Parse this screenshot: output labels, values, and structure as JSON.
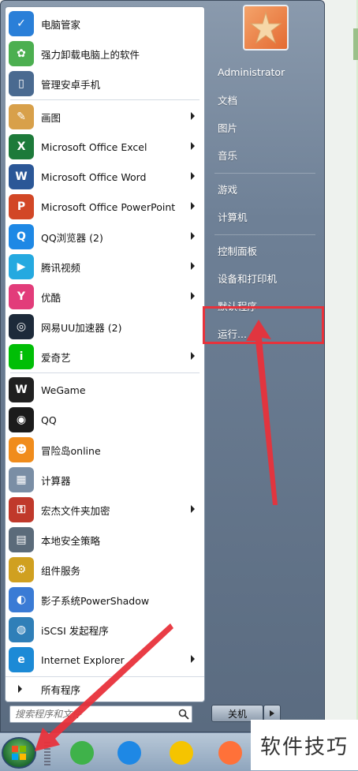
{
  "programs": [
    {
      "label": "电脑管家",
      "icon": "shield-icon",
      "color": "#2a7fd8",
      "submenu": false
    },
    {
      "label": "强力卸载电脑上的软件",
      "icon": "clover-icon",
      "color": "#4caf50",
      "submenu": false
    },
    {
      "label": "管理安卓手机",
      "icon": "phone-icon",
      "color": "#4a6a90",
      "submenu": false
    },
    {
      "label": "画图",
      "icon": "palette-icon",
      "color": "#d8a04a",
      "submenu": true
    },
    {
      "label": "Microsoft Office Excel",
      "icon": "excel-icon",
      "color": "#1d7a3a",
      "submenu": true
    },
    {
      "label": "Microsoft Office Word",
      "icon": "word-icon",
      "color": "#2b5797",
      "submenu": true
    },
    {
      "label": "Microsoft Office PowerPoint",
      "icon": "powerpoint-icon",
      "color": "#d24726",
      "submenu": true
    },
    {
      "label": "QQ浏览器 (2)",
      "icon": "qq-browser-icon",
      "color": "#1e88e5",
      "submenu": true
    },
    {
      "label": "腾讯视频",
      "icon": "tencent-video-icon",
      "color": "#25a9e0",
      "submenu": true
    },
    {
      "label": "优酷",
      "icon": "youku-icon",
      "color": "#e23c7a",
      "submenu": true
    },
    {
      "label": "网易UU加速器 (2)",
      "icon": "uu-accelerator-icon",
      "color": "#1d2a3a",
      "submenu": false
    },
    {
      "label": "爱奇艺",
      "icon": "iqiyi-icon",
      "color": "#00be06",
      "submenu": true
    },
    {
      "label": "WeGame",
      "icon": "wegame-icon",
      "color": "#202020",
      "submenu": false
    },
    {
      "label": "QQ",
      "icon": "qq-penguin-icon",
      "color": "#1b1b1b",
      "submenu": false
    },
    {
      "label": "冒险岛online",
      "icon": "maplestory-icon",
      "color": "#f08c1c",
      "submenu": false
    },
    {
      "label": "计算器",
      "icon": "calculator-icon",
      "color": "#7a8ea5",
      "submenu": false
    },
    {
      "label": "宏杰文件夹加密",
      "icon": "lock-icon",
      "color": "#c0392b",
      "submenu": true
    },
    {
      "label": "本地安全策略",
      "icon": "security-policy-icon",
      "color": "#5b6b7a",
      "submenu": false
    },
    {
      "label": "组件服务",
      "icon": "component-services-icon",
      "color": "#d0a020",
      "submenu": false
    },
    {
      "label": "影子系统PowerShadow",
      "icon": "powershadow-icon",
      "color": "#3a7bd5",
      "submenu": false
    },
    {
      "label": "iSCSI 发起程序",
      "icon": "iscsi-globe-icon",
      "color": "#2f7fb8",
      "submenu": false
    },
    {
      "label": "Internet Explorer",
      "icon": "internet-explorer-icon",
      "color": "#1c8ad6",
      "submenu": true
    }
  ],
  "all_programs_label": "所有程序",
  "search": {
    "placeholder": "搜索程序和文件"
  },
  "right_pane": {
    "user": "Administrator",
    "links_group1": [
      "文档",
      "图片",
      "音乐"
    ],
    "links_group2": [
      "游戏",
      "计算机"
    ],
    "links_group3": [
      "控制面板",
      "设备和打印机",
      "默认程序",
      "运行..."
    ]
  },
  "shutdown_label": "关机",
  "taskbar_items": [
    "wechat-icon",
    "qq-browser-icon",
    "qq-music-icon",
    "firefox-icon"
  ],
  "watermark": "软件技巧",
  "colors": {
    "highlight": "#e8323b",
    "arrow": "#e8323b"
  }
}
